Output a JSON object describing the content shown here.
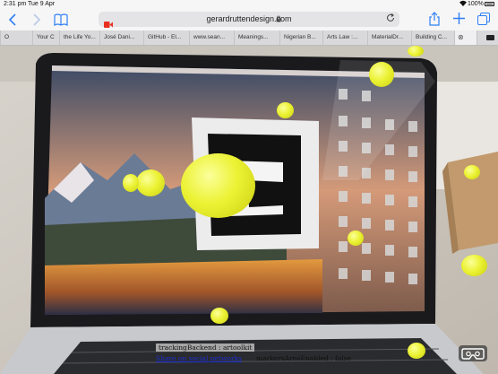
{
  "status_bar": {
    "time": "2:31 pm",
    "date": "Tue 9 Apr",
    "battery_percent": "100%"
  },
  "browser": {
    "url": "gerardruttendesign.com",
    "tabs": [
      "O",
      "Your C",
      "the Life Yo...",
      "José Dani...",
      "GitHub - El...",
      "www.sean...",
      "Meanings...",
      "Nigerian B...",
      "Arts Law :...",
      "MaterialDr...",
      "Building C...",
      "",
      ""
    ],
    "active_tab_index": 11
  },
  "overlay": {
    "tracking_label": "trackingBackend : artoolkit",
    "share_link": "Share on social networks",
    "marker_label": "markersAreaEnabled : false"
  },
  "colors": {
    "accent": "#2f7ff6",
    "sphere": "#ecf234",
    "recording": "#e8301f"
  }
}
